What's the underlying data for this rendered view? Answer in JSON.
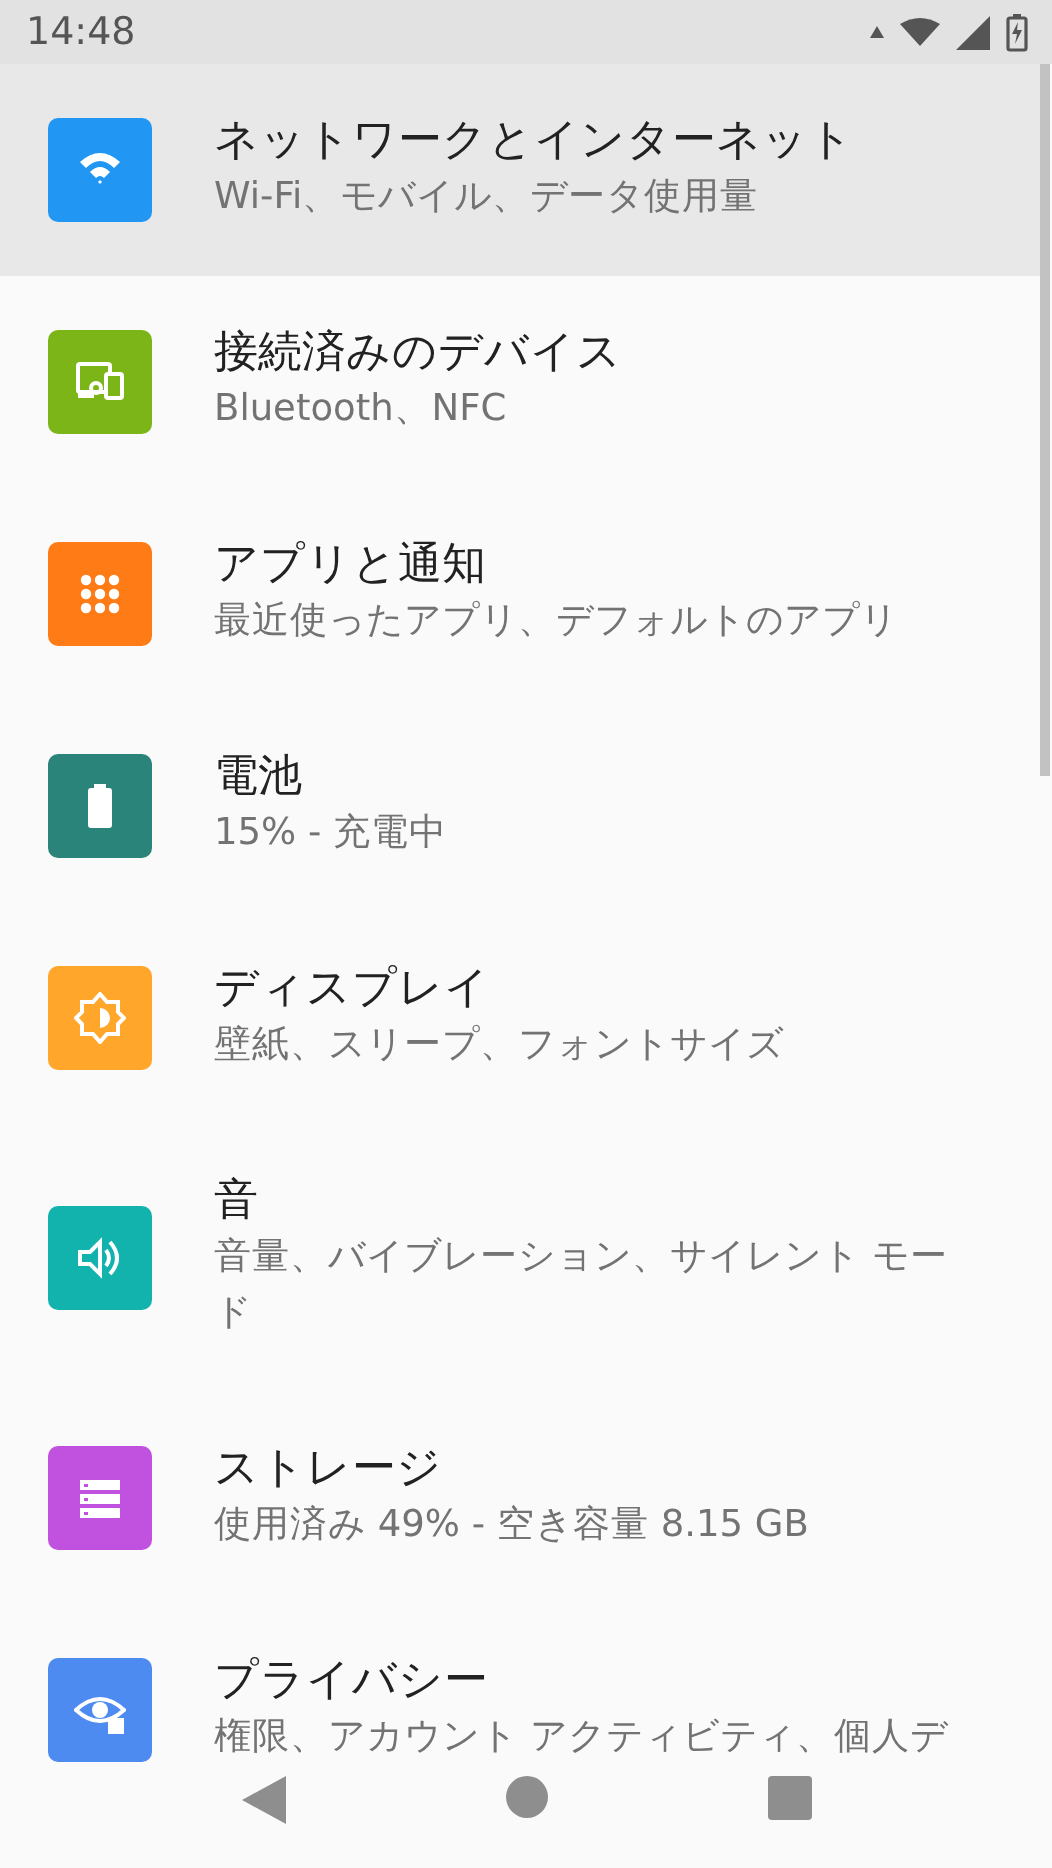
{
  "status_bar": {
    "time": "14:48"
  },
  "settings": [
    {
      "kind": "wifi",
      "color": "#2196f3",
      "title": "ネットワークとインターネット",
      "subtitle": "Wi-Fi、モバイル、データ使用量",
      "selected": true
    },
    {
      "kind": "devices",
      "color": "#7cb518",
      "title": "接続済みのデバイス",
      "subtitle": "Bluetooth、NFC",
      "selected": false
    },
    {
      "kind": "apps",
      "color": "#ff7b15",
      "title": "アプリと通知",
      "subtitle": "最近使ったアプリ、デフォルトのアプリ",
      "selected": false
    },
    {
      "kind": "battery",
      "color": "#2a8479",
      "title": "電池",
      "subtitle": "15% - 充電中",
      "selected": false
    },
    {
      "kind": "display",
      "color": "#ffa62b",
      "title": "ディスプレイ",
      "subtitle": "壁紙、スリープ、フォントサイズ",
      "selected": false
    },
    {
      "kind": "sound",
      "color": "#12b3ad",
      "title": "音",
      "subtitle": "音量、バイブレーション、サイレント モード",
      "selected": false
    },
    {
      "kind": "storage",
      "color": "#c152e0",
      "title": "ストレージ",
      "subtitle": "使用済み 49% - 空き容量 8.15 GB",
      "selected": false
    },
    {
      "kind": "privacy",
      "color": "#4d8bf0",
      "title": "プライバシー",
      "subtitle": "権限、アカウント アクティビティ、個人デ",
      "selected": false
    }
  ]
}
